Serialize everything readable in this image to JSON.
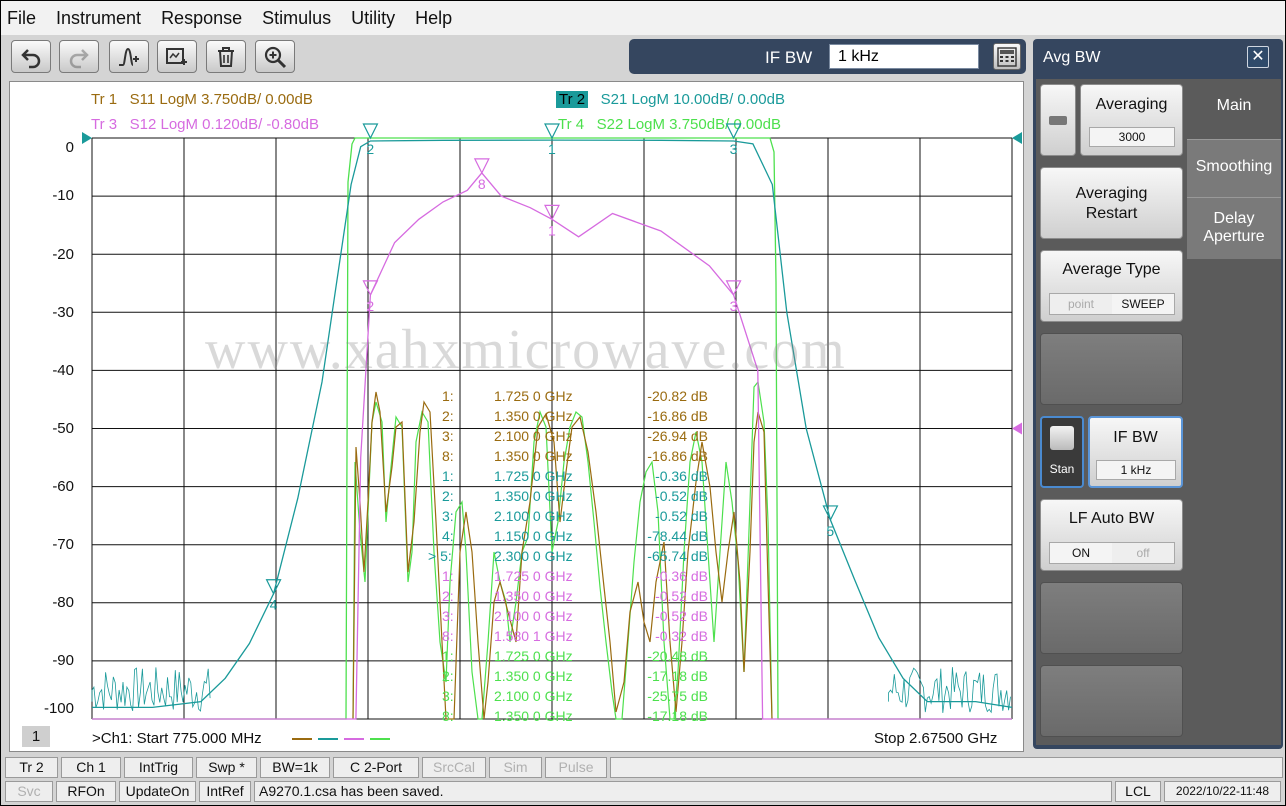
{
  "menu": [
    "File",
    "Instrument",
    "Response",
    "Stimulus",
    "Utility",
    "Help"
  ],
  "toolbar": {
    "buttons": [
      "undo-icon",
      "redo-icon",
      "add-marker-icon",
      "add-trace-icon",
      "delete-icon",
      "zoom-icon"
    ],
    "ifbw_label": "IF BW",
    "ifbw_value": "1 kHz"
  },
  "traces": {
    "tr1": {
      "id": "Tr 1",
      "desc": "S11 LogM 3.750dB/  0.00dB",
      "color": "#9a6b10"
    },
    "tr2": {
      "id": "Tr 2",
      "desc": "S21 LogM 10.00dB/  0.00dB",
      "color": "#1a9a9a"
    },
    "tr3": {
      "id": "Tr 3",
      "desc": "S12 LogM 0.120dB/  -0.80dB",
      "color": "#d66be0"
    },
    "tr4": {
      "id": "Tr 4",
      "desc": "S22 LogM 3.750dB/  0.00dB",
      "color": "#4de04d"
    }
  },
  "y_labels": [
    "0",
    "-10",
    "-20",
    "-30",
    "-40",
    "-50",
    "-60",
    "-70",
    "-80",
    "-90",
    "-100"
  ],
  "watermark": "www.xahxmicrowave.com",
  "markers": [
    {
      "n": "1:",
      "f": "1.725 0 GHz",
      "v": "-20.82 dB",
      "c": "#9a6b10"
    },
    {
      "n": "2:",
      "f": "1.350 0 GHz",
      "v": "-16.86 dB",
      "c": "#9a6b10"
    },
    {
      "n": "3:",
      "f": "2.100 0 GHz",
      "v": "-26.94 dB",
      "c": "#9a6b10"
    },
    {
      "n": "8:",
      "f": "1.350 0 GHz",
      "v": "-16.86 dB",
      "c": "#9a6b10"
    },
    {
      "n": "1:",
      "f": "1.725 0 GHz",
      "v": "-0.36 dB",
      "c": "#1a9a9a"
    },
    {
      "n": "2:",
      "f": "1.350 0 GHz",
      "v": "-0.52 dB",
      "c": "#1a9a9a"
    },
    {
      "n": "3:",
      "f": "2.100 0 GHz",
      "v": "-0.52 dB",
      "c": "#1a9a9a"
    },
    {
      "n": "4:",
      "f": "1.150 0 GHz",
      "v": "-78.44 dB",
      "c": "#1a9a9a"
    },
    {
      "n": "> 5:",
      "f": "2.300 0 GHz",
      "v": "-65.74 dB",
      "c": "#1a9a9a"
    },
    {
      "n": "1:",
      "f": "1.725 0 GHz",
      "v": "-0.36 dB",
      "c": "#d66be0"
    },
    {
      "n": "2:",
      "f": "1.350 0 GHz",
      "v": "-0.52 dB",
      "c": "#d66be0"
    },
    {
      "n": "3:",
      "f": "2.100 0 GHz",
      "v": "-0.52 dB",
      "c": "#d66be0"
    },
    {
      "n": "8:",
      "f": "1.580 1 GHz",
      "v": "-0.32 dB",
      "c": "#d66be0"
    },
    {
      "n": "1:",
      "f": "1.725 0 GHz",
      "v": "-20.48 dB",
      "c": "#4de04d"
    },
    {
      "n": "2:",
      "f": "1.350 0 GHz",
      "v": "-17.18 dB",
      "c": "#4de04d"
    },
    {
      "n": "3:",
      "f": "2.100 0 GHz",
      "v": "-25.75 dB",
      "c": "#4de04d"
    },
    {
      "n": "8:",
      "f": "1.350 0 GHz",
      "v": "-17.18 dB",
      "c": "#4de04d"
    }
  ],
  "plot_markers": [
    {
      "label": "2",
      "freq": 1.35,
      "db": 0,
      "color": "#1a9a9a"
    },
    {
      "label": "1",
      "freq": 1.725,
      "db": 0,
      "color": "#1a9a9a"
    },
    {
      "label": "3",
      "freq": 2.1,
      "db": 0,
      "color": "#1a9a9a"
    },
    {
      "label": "4",
      "freq": 1.15,
      "db": -78.44,
      "color": "#1a9a9a"
    },
    {
      "label": "5",
      "freq": 2.3,
      "db": -65.74,
      "color": "#1a9a9a"
    },
    {
      "label": "8",
      "freq": 1.5801,
      "db": -6,
      "color": "#d66be0"
    },
    {
      "label": "1",
      "freq": 1.725,
      "db": -14,
      "color": "#d66be0"
    },
    {
      "label": "2",
      "freq": 1.35,
      "db": -27,
      "color": "#d66be0"
    },
    {
      "label": "3",
      "freq": 2.1,
      "db": -27,
      "color": "#d66be0"
    }
  ],
  "channel": {
    "number": "1",
    "start": ">Ch1:  Start   775.000 MHz",
    "stop": "Stop  2.67500 GHz"
  },
  "panel": {
    "title": "Avg BW",
    "tabs": [
      "Main",
      "Smoothing",
      "Delay\nAperture"
    ],
    "averaging_label": "Averaging",
    "averaging_value": "3000",
    "restart_label": "Averaging\nRestart",
    "avg_type_label": "Average Type",
    "avg_type_options": [
      "point",
      "SWEEP"
    ],
    "stan_label": "Stan",
    "ifbw_label": "IF BW",
    "ifbw_value": "1 kHz",
    "lf_label": "LF Auto BW",
    "lf_options": [
      "ON",
      "off"
    ]
  },
  "status_row1": [
    {
      "t": "Tr 2",
      "dim": false
    },
    {
      "t": "Ch 1",
      "dim": false
    },
    {
      "t": "IntTrig",
      "dim": false
    },
    {
      "t": "Swp *",
      "dim": false
    },
    {
      "t": "BW=1k",
      "dim": false
    },
    {
      "t": "C  2-Port",
      "dim": false
    },
    {
      "t": "SrcCal",
      "dim": true
    },
    {
      "t": "Sim",
      "dim": true
    },
    {
      "t": "Pulse",
      "dim": true
    }
  ],
  "status_row2": [
    {
      "t": "Svc",
      "dim": true
    },
    {
      "t": "RFOn",
      "dim": false
    },
    {
      "t": "UpdateOn",
      "dim": false
    },
    {
      "t": "IntRef",
      "dim": false
    }
  ],
  "status_message": "A9270.1.csa has been saved.",
  "status_lcl": "LCL",
  "status_time": "2022/10/22-11:48",
  "chart_data": {
    "type": "line",
    "xlim": [
      0.775,
      2.675
    ],
    "ylim": [
      -100,
      0
    ],
    "grid": true,
    "series": [
      {
        "name": "S21",
        "color": "#1a9a9a",
        "x": [
          0.775,
          0.9,
          1.0,
          1.05,
          1.1,
          1.15,
          1.2,
          1.25,
          1.28,
          1.31,
          1.33,
          1.35,
          1.5,
          1.725,
          1.95,
          2.1,
          2.14,
          2.18,
          2.21,
          2.25,
          2.3,
          2.35,
          2.4,
          2.45,
          2.5,
          2.6,
          2.675
        ],
        "y": [
          -98,
          -98,
          -97,
          -93,
          -87,
          -78.44,
          -62,
          -42,
          -25,
          -8,
          -1.5,
          -0.52,
          -0.4,
          -0.36,
          -0.4,
          -0.52,
          -1,
          -8,
          -30,
          -50,
          -65.74,
          -76,
          -86,
          -93,
          -97,
          -97,
          -98
        ]
      },
      {
        "name": "S12",
        "color": "#d66be0",
        "x": [
          0.775,
          1.32,
          1.33,
          1.35,
          1.4,
          1.45,
          1.5,
          1.55,
          1.58,
          1.62,
          1.68,
          1.725,
          1.78,
          1.85,
          1.95,
          2.05,
          2.1,
          2.15,
          2.16,
          2.675
        ],
        "y": [
          -100,
          -100,
          -55,
          -27,
          -18,
          -14,
          -11,
          -9,
          -6,
          -10,
          -12,
          -14,
          -17,
          -13,
          -16,
          -22,
          -27,
          -40,
          -100,
          -100
        ]
      }
    ]
  }
}
